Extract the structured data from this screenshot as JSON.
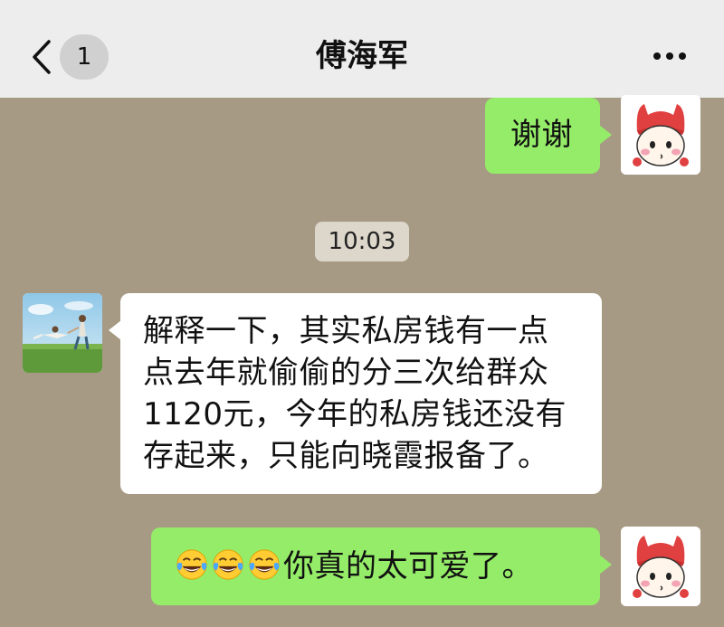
{
  "header": {
    "unread_count": "1",
    "title": "傅海军"
  },
  "messages": [
    {
      "side": "right",
      "text": "谢谢"
    },
    {
      "side": "left",
      "lines": [
        "解释一下，其实私房钱有一点",
        "点去年就偷偷的分三次给群众",
        "1120元，今年的私房钱还没有",
        "存起来，只能向晓霞报备了。"
      ]
    },
    {
      "side": "right",
      "emoji_count": 3,
      "emoji": "tears-of-joy",
      "text": "你真的太可爱了。"
    }
  ],
  "timestamp": "10:03"
}
